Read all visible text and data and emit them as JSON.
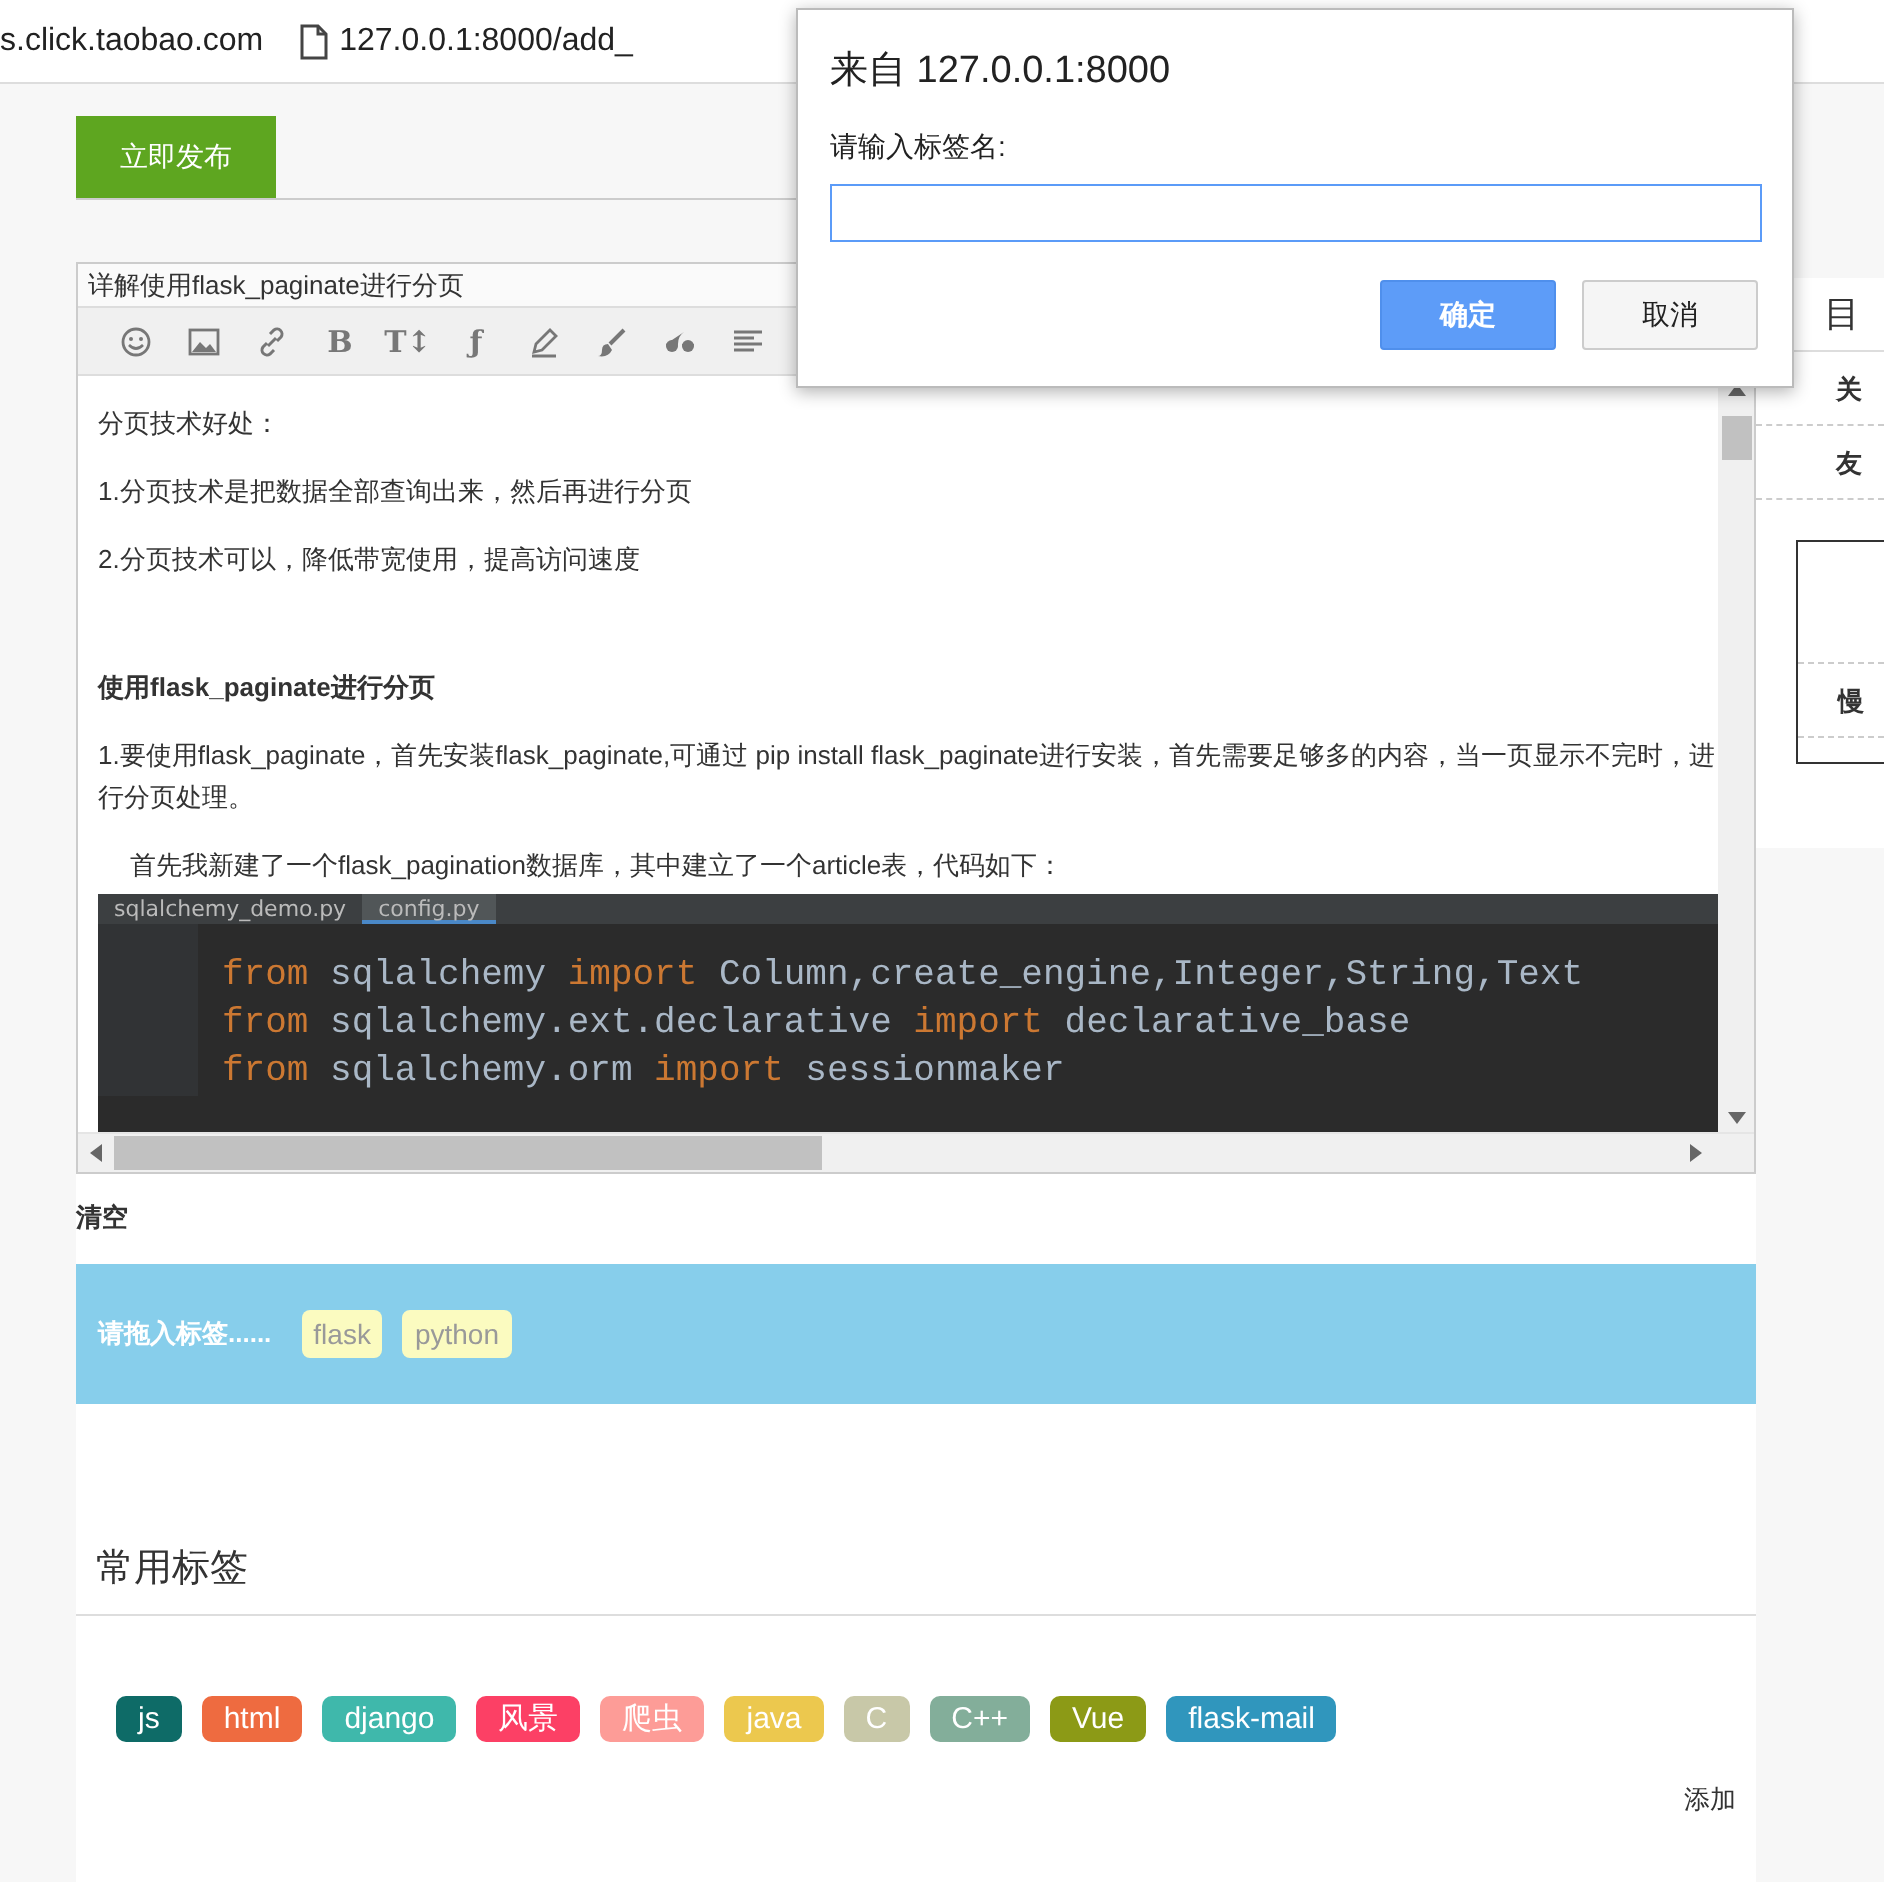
{
  "address_bar": {
    "site": "s.click.taobao.com",
    "url": "127.0.0.1:8000/add_"
  },
  "publish_button": {
    "label": "立即发布"
  },
  "editor": {
    "title": "详解使用flask_paginate进行分页",
    "toolbar": [
      {
        "kind": "smile"
      },
      {
        "kind": "image"
      },
      {
        "kind": "link"
      },
      {
        "kind": "text",
        "label": "B"
      },
      {
        "kind": "text",
        "label": "T↕"
      },
      {
        "kind": "text",
        "label": "ƒ"
      },
      {
        "kind": "pencil"
      },
      {
        "kind": "brush"
      },
      {
        "kind": "quote"
      },
      {
        "kind": "align"
      }
    ],
    "content": [
      {
        "kind": "para",
        "text": "分页技术好处："
      },
      {
        "kind": "para",
        "text": "1.分页技术是把数据全部查询出来，然后再进行分页"
      },
      {
        "kind": "para",
        "text": "2.分页技术可以，降低带宽使用，提高访问速度"
      },
      {
        "kind": "blank"
      },
      {
        "kind": "heading",
        "text": "使用flask_paginate进行分页"
      },
      {
        "kind": "para",
        "text": "1.要使用flask_paginate，首先安装flask_paginate,可通过 pip install flask_paginate进行安装，首先需要足够多的内容，当一页显示不完时，进行分页处理。"
      },
      {
        "kind": "indent",
        "text": "首先我新建了一个flask_pagination数据库，其中建立了一个article表，代码如下："
      },
      {
        "kind": "code",
        "tabs": [
          {
            "label": "sqlalchemy_demo.py",
            "selected": false
          },
          {
            "label": "config.py",
            "selected": true
          }
        ],
        "lines": [
          [
            {
              "kind": "keyword",
              "text": "from"
            },
            {
              "kind": "plain",
              "text": " sqlalchemy "
            },
            {
              "kind": "keyword",
              "text": "import"
            },
            {
              "kind": "plain",
              "text": " Column,create_engine,Integer,String,Text"
            }
          ],
          [
            {
              "kind": "keyword",
              "text": "from"
            },
            {
              "kind": "plain",
              "text": " sqlalchemy.ext.declarative "
            },
            {
              "kind": "keyword",
              "text": "import"
            },
            {
              "kind": "plain",
              "text": " declarative_base"
            }
          ],
          [
            {
              "kind": "keyword",
              "text": "from"
            },
            {
              "kind": "plain",
              "text": " sqlalchemy.orm "
            },
            {
              "kind": "keyword",
              "text": "import"
            },
            {
              "kind": "plain",
              "text": " sessionmaker"
            }
          ]
        ]
      }
    ]
  },
  "clear_link": "清空",
  "drop_zone": {
    "hint": "请拖入标签......",
    "tags": [
      "flask",
      "python"
    ]
  },
  "common_tags": {
    "heading": "常用标签",
    "items": [
      {
        "label": "js",
        "color": "#0e6b67"
      },
      {
        "label": "html",
        "color": "#ee6b40"
      },
      {
        "label": "django",
        "color": "#3fb8ab"
      },
      {
        "label": "风景",
        "color": "#fc4065"
      },
      {
        "label": "爬虫",
        "color": "#fd9c97"
      },
      {
        "label": "java",
        "color": "#ecc84e"
      },
      {
        "label": "C",
        "color": "#c8c8a8"
      },
      {
        "label": "C++",
        "color": "#83ae9a"
      },
      {
        "label": "Vue",
        "color": "#8c9a16"
      },
      {
        "label": "flask-mail",
        "color": "#3096bd"
      }
    ],
    "add": "添加"
  },
  "sidebar": {
    "heading": "目",
    "items": [
      "关",
      "友"
    ],
    "box_items": [
      "慢"
    ]
  },
  "dialog": {
    "title": "来自 127.0.0.1:8000",
    "label": "请输入标签名:",
    "buttons": [
      {
        "label": "确定",
        "primary": true
      },
      {
        "label": "取消",
        "primary": false
      }
    ]
  }
}
